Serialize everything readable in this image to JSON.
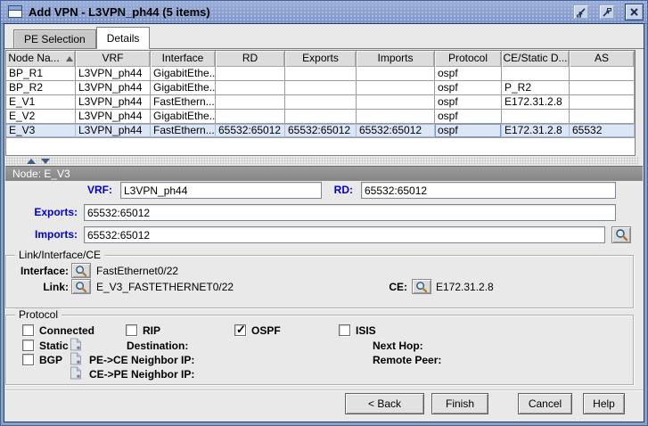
{
  "window": {
    "title": "Add VPN - L3VPN_ph44 (5 items)"
  },
  "colors": {
    "titlebar_blue": "#8094c8",
    "selection_blue": "#dce6f5",
    "label_blue": "#0000cc"
  },
  "tabs": {
    "pe_selection": "PE Selection",
    "details": "Details"
  },
  "table": {
    "columns": [
      "Node Na...",
      "VRF",
      "Interface",
      "RD",
      "Exports",
      "Imports",
      "Protocol",
      "CE/Static D...",
      "AS"
    ],
    "sort": {
      "column": "Node Na...",
      "direction": "asc"
    },
    "selected_row": "E_V3",
    "rows": [
      {
        "cells": [
          "BP_R1",
          "L3VPN_ph44",
          "GigabitEthe...",
          "",
          "",
          "",
          "ospf",
          "",
          ""
        ]
      },
      {
        "cells": [
          "BP_R2",
          "L3VPN_ph44",
          "GigabitEthe...",
          "",
          "",
          "",
          "ospf",
          "P_R2",
          ""
        ]
      },
      {
        "cells": [
          "E_V1",
          "L3VPN_ph44",
          "FastEthern...",
          "",
          "",
          "",
          "ospf",
          "E172.31.2.8",
          ""
        ]
      },
      {
        "cells": [
          "E_V2",
          "L3VPN_ph44",
          "GigabitEthe...",
          "",
          "",
          "",
          "ospf",
          "",
          ""
        ]
      },
      {
        "cells": [
          "E_V3",
          "L3VPN_ph44",
          "FastEthern...",
          "65532:65012",
          "65532:65012",
          "65532:65012",
          "ospf",
          "E172.31.2.8",
          "65532"
        ]
      }
    ]
  },
  "detail": {
    "header": "Node: E_V3",
    "fields": {
      "vrf": {
        "label": "VRF:",
        "value": "L3VPN_ph44"
      },
      "rd": {
        "label": "RD:",
        "value": "65532:65012"
      },
      "exports": {
        "label": "Exports:",
        "value": "65532:65012"
      },
      "imports": {
        "label": "Imports:",
        "value": "65532:65012"
      }
    },
    "link_group": {
      "title": "Link/Interface/CE",
      "interface_label": "Interface:",
      "interface_value": "FastEthernet0/22",
      "link_label": "Link:",
      "link_value": "E_V3_FASTETHERNET0/22",
      "ce_label": "CE:",
      "ce_value": "E172.31.2.8"
    },
    "protocol_group": {
      "title": "Protocol",
      "options": [
        {
          "label": "Connected",
          "checked": false
        },
        {
          "label": "RIP",
          "checked": false
        },
        {
          "label": "OSPF",
          "checked": true
        },
        {
          "label": "ISIS",
          "checked": false
        },
        {
          "label": "Static",
          "checked": false
        },
        {
          "label": "BGP",
          "checked": false
        }
      ],
      "destination_label": "Destination:",
      "pe_ce_label": "PE->CE Neighbor IP:",
      "ce_pe_label": "CE->PE Neighbor IP:",
      "next_hop_label": "Next Hop:",
      "remote_peer_label": "Remote Peer:"
    }
  },
  "footer": {
    "back_label": "< Back",
    "finish_label": "Finish",
    "cancel_label": "Cancel",
    "help_label": "Help"
  }
}
